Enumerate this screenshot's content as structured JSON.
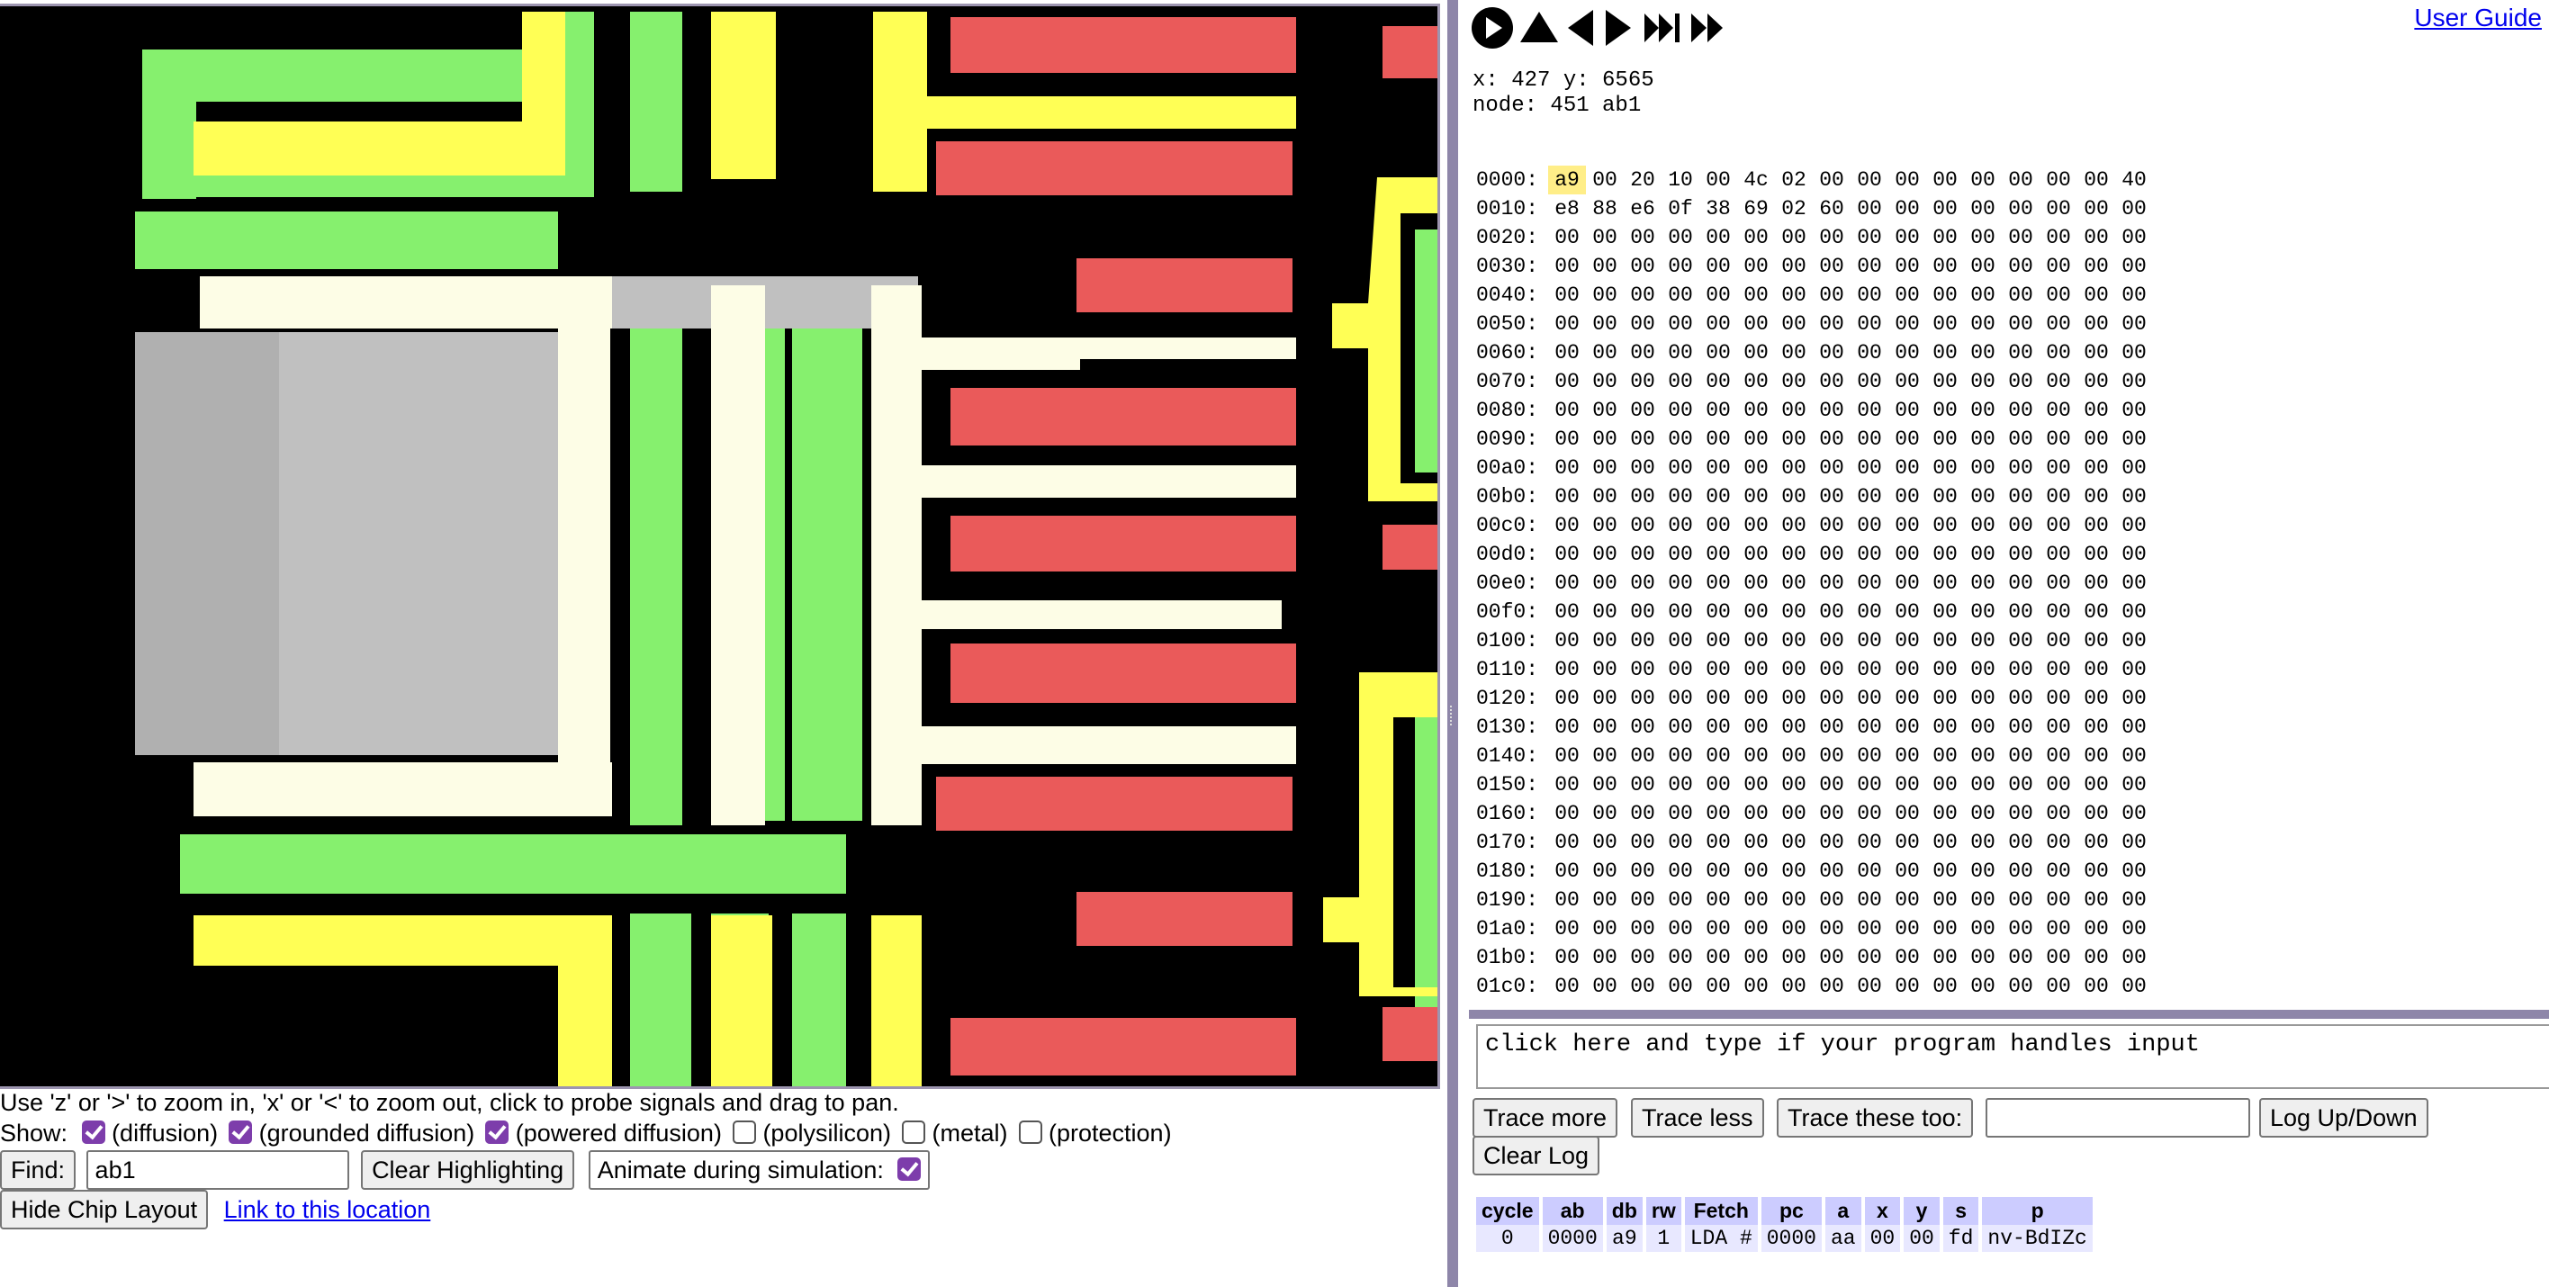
{
  "colors": {
    "diffusion": "#86f06e",
    "powered_diffusion": "#ffff55",
    "grounded_diffusion": "#ea5a5a",
    "polysilicon_highlight": "#fdfde6",
    "metal": "#c0c0c0",
    "accent": "#8e86a9",
    "checkbox": "#7d3dab"
  },
  "toolbar": {
    "buttons": [
      "play-icon",
      "step-back-icon",
      "rewind-icon",
      "forward-icon",
      "fast-forward-icon",
      "skip-forward-icon"
    ],
    "user_guide": "User Guide"
  },
  "probe": {
    "coords": "x: 427 y: 6565",
    "node": "node: 451 ab1"
  },
  "memory": {
    "rows": [
      {
        "addr": "0000:",
        "bytes": [
          "a9",
          "00",
          "20",
          "10",
          "00",
          "4c",
          "02",
          "00",
          "00",
          "00",
          "00",
          "00",
          "00",
          "00",
          "00",
          "40"
        ]
      },
      {
        "addr": "0010:",
        "bytes": [
          "e8",
          "88",
          "e6",
          "0f",
          "38",
          "69",
          "02",
          "60",
          "00",
          "00",
          "00",
          "00",
          "00",
          "00",
          "00",
          "00"
        ]
      },
      {
        "addr": "0020:",
        "bytes": [
          "00",
          "00",
          "00",
          "00",
          "00",
          "00",
          "00",
          "00",
          "00",
          "00",
          "00",
          "00",
          "00",
          "00",
          "00",
          "00"
        ]
      },
      {
        "addr": "0030:",
        "bytes": [
          "00",
          "00",
          "00",
          "00",
          "00",
          "00",
          "00",
          "00",
          "00",
          "00",
          "00",
          "00",
          "00",
          "00",
          "00",
          "00"
        ]
      },
      {
        "addr": "0040:",
        "bytes": [
          "00",
          "00",
          "00",
          "00",
          "00",
          "00",
          "00",
          "00",
          "00",
          "00",
          "00",
          "00",
          "00",
          "00",
          "00",
          "00"
        ]
      },
      {
        "addr": "0050:",
        "bytes": [
          "00",
          "00",
          "00",
          "00",
          "00",
          "00",
          "00",
          "00",
          "00",
          "00",
          "00",
          "00",
          "00",
          "00",
          "00",
          "00"
        ]
      },
      {
        "addr": "0060:",
        "bytes": [
          "00",
          "00",
          "00",
          "00",
          "00",
          "00",
          "00",
          "00",
          "00",
          "00",
          "00",
          "00",
          "00",
          "00",
          "00",
          "00"
        ]
      },
      {
        "addr": "0070:",
        "bytes": [
          "00",
          "00",
          "00",
          "00",
          "00",
          "00",
          "00",
          "00",
          "00",
          "00",
          "00",
          "00",
          "00",
          "00",
          "00",
          "00"
        ]
      },
      {
        "addr": "0080:",
        "bytes": [
          "00",
          "00",
          "00",
          "00",
          "00",
          "00",
          "00",
          "00",
          "00",
          "00",
          "00",
          "00",
          "00",
          "00",
          "00",
          "00"
        ]
      },
      {
        "addr": "0090:",
        "bytes": [
          "00",
          "00",
          "00",
          "00",
          "00",
          "00",
          "00",
          "00",
          "00",
          "00",
          "00",
          "00",
          "00",
          "00",
          "00",
          "00"
        ]
      },
      {
        "addr": "00a0:",
        "bytes": [
          "00",
          "00",
          "00",
          "00",
          "00",
          "00",
          "00",
          "00",
          "00",
          "00",
          "00",
          "00",
          "00",
          "00",
          "00",
          "00"
        ]
      },
      {
        "addr": "00b0:",
        "bytes": [
          "00",
          "00",
          "00",
          "00",
          "00",
          "00",
          "00",
          "00",
          "00",
          "00",
          "00",
          "00",
          "00",
          "00",
          "00",
          "00"
        ]
      },
      {
        "addr": "00c0:",
        "bytes": [
          "00",
          "00",
          "00",
          "00",
          "00",
          "00",
          "00",
          "00",
          "00",
          "00",
          "00",
          "00",
          "00",
          "00",
          "00",
          "00"
        ]
      },
      {
        "addr": "00d0:",
        "bytes": [
          "00",
          "00",
          "00",
          "00",
          "00",
          "00",
          "00",
          "00",
          "00",
          "00",
          "00",
          "00",
          "00",
          "00",
          "00",
          "00"
        ]
      },
      {
        "addr": "00e0:",
        "bytes": [
          "00",
          "00",
          "00",
          "00",
          "00",
          "00",
          "00",
          "00",
          "00",
          "00",
          "00",
          "00",
          "00",
          "00",
          "00",
          "00"
        ]
      },
      {
        "addr": "00f0:",
        "bytes": [
          "00",
          "00",
          "00",
          "00",
          "00",
          "00",
          "00",
          "00",
          "00",
          "00",
          "00",
          "00",
          "00",
          "00",
          "00",
          "00"
        ]
      },
      {
        "addr": "0100:",
        "bytes": [
          "00",
          "00",
          "00",
          "00",
          "00",
          "00",
          "00",
          "00",
          "00",
          "00",
          "00",
          "00",
          "00",
          "00",
          "00",
          "00"
        ]
      },
      {
        "addr": "0110:",
        "bytes": [
          "00",
          "00",
          "00",
          "00",
          "00",
          "00",
          "00",
          "00",
          "00",
          "00",
          "00",
          "00",
          "00",
          "00",
          "00",
          "00"
        ]
      },
      {
        "addr": "0120:",
        "bytes": [
          "00",
          "00",
          "00",
          "00",
          "00",
          "00",
          "00",
          "00",
          "00",
          "00",
          "00",
          "00",
          "00",
          "00",
          "00",
          "00"
        ]
      },
      {
        "addr": "0130:",
        "bytes": [
          "00",
          "00",
          "00",
          "00",
          "00",
          "00",
          "00",
          "00",
          "00",
          "00",
          "00",
          "00",
          "00",
          "00",
          "00",
          "00"
        ]
      },
      {
        "addr": "0140:",
        "bytes": [
          "00",
          "00",
          "00",
          "00",
          "00",
          "00",
          "00",
          "00",
          "00",
          "00",
          "00",
          "00",
          "00",
          "00",
          "00",
          "00"
        ]
      },
      {
        "addr": "0150:",
        "bytes": [
          "00",
          "00",
          "00",
          "00",
          "00",
          "00",
          "00",
          "00",
          "00",
          "00",
          "00",
          "00",
          "00",
          "00",
          "00",
          "00"
        ]
      },
      {
        "addr": "0160:",
        "bytes": [
          "00",
          "00",
          "00",
          "00",
          "00",
          "00",
          "00",
          "00",
          "00",
          "00",
          "00",
          "00",
          "00",
          "00",
          "00",
          "00"
        ]
      },
      {
        "addr": "0170:",
        "bytes": [
          "00",
          "00",
          "00",
          "00",
          "00",
          "00",
          "00",
          "00",
          "00",
          "00",
          "00",
          "00",
          "00",
          "00",
          "00",
          "00"
        ]
      },
      {
        "addr": "0180:",
        "bytes": [
          "00",
          "00",
          "00",
          "00",
          "00",
          "00",
          "00",
          "00",
          "00",
          "00",
          "00",
          "00",
          "00",
          "00",
          "00",
          "00"
        ]
      },
      {
        "addr": "0190:",
        "bytes": [
          "00",
          "00",
          "00",
          "00",
          "00",
          "00",
          "00",
          "00",
          "00",
          "00",
          "00",
          "00",
          "00",
          "00",
          "00",
          "00"
        ]
      },
      {
        "addr": "01a0:",
        "bytes": [
          "00",
          "00",
          "00",
          "00",
          "00",
          "00",
          "00",
          "00",
          "00",
          "00",
          "00",
          "00",
          "00",
          "00",
          "00",
          "00"
        ]
      },
      {
        "addr": "01b0:",
        "bytes": [
          "00",
          "00",
          "00",
          "00",
          "00",
          "00",
          "00",
          "00",
          "00",
          "00",
          "00",
          "00",
          "00",
          "00",
          "00",
          "00"
        ]
      },
      {
        "addr": "01c0:",
        "bytes": [
          "00",
          "00",
          "00",
          "00",
          "00",
          "00",
          "00",
          "00",
          "00",
          "00",
          "00",
          "00",
          "00",
          "00",
          "00",
          "00"
        ]
      }
    ],
    "highlight_addr": "0000:",
    "highlight_byte": 0
  },
  "console": {
    "placeholder": "click here and type if your program handles input"
  },
  "buttons": {
    "trace_more": "Trace more",
    "trace_less": "Trace less",
    "trace_these": "Trace these too:",
    "log_updown": "Log Up/Down",
    "clear_log": "Clear Log"
  },
  "trace": {
    "headers": [
      "cycle",
      "ab",
      "db",
      "rw",
      "Fetch",
      "pc",
      "a",
      "x",
      "y",
      "s",
      "p"
    ],
    "rows": [
      [
        "0",
        "0000",
        "a9",
        "1",
        "LDA #",
        "0000",
        "aa",
        "00",
        "00",
        "fd",
        "nv‐BdIZc"
      ]
    ]
  },
  "left": {
    "help": "Use 'z' or '>' to zoom in, 'x' or '<' to zoom out, click to probe signals and drag to pan.",
    "show_label": "Show:",
    "layers": [
      {
        "label": "(diffusion)",
        "checked": true
      },
      {
        "label": "(grounded diffusion)",
        "checked": true
      },
      {
        "label": "(powered diffusion)",
        "checked": true
      },
      {
        "label": "(polysilicon)",
        "checked": false
      },
      {
        "label": "(metal)",
        "checked": false
      },
      {
        "label": "(protection)",
        "checked": false
      }
    ],
    "find_label": "Find:",
    "find_value": "ab1",
    "clear_highlighting": "Clear Highlighting",
    "animate_label": "Animate during simulation:",
    "animate_checked": true,
    "hide_layout": "Hide Chip Layout",
    "link_location": "Link to this location"
  }
}
